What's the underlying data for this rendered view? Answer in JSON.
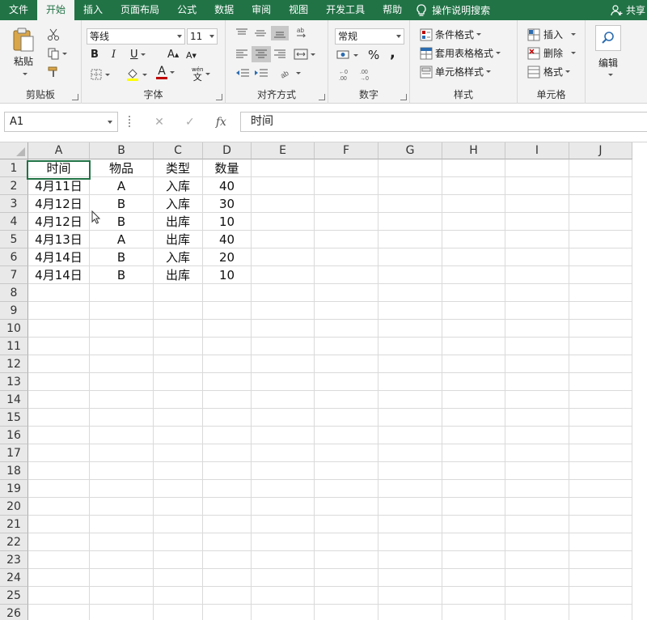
{
  "menu": {
    "tabs": [
      "文件",
      "开始",
      "插入",
      "页面布局",
      "公式",
      "数据",
      "审阅",
      "视图",
      "开发工具",
      "帮助"
    ],
    "active_tab": "开始",
    "tell_me": "操作说明搜索",
    "share": "共享"
  },
  "ribbon": {
    "clipboard": {
      "label": "剪贴板",
      "paste": "粘贴"
    },
    "font": {
      "label": "字体",
      "font_name": "等线",
      "font_size": "11",
      "bold": "B",
      "italic": "I",
      "underline": "U",
      "grow": "A",
      "shrink": "A",
      "color_letter": "A",
      "phonetic_top": "wén",
      "phonetic": "文"
    },
    "alignment": {
      "label": "对齐方式"
    },
    "number": {
      "label": "数字",
      "format": "常规",
      "percent": "%",
      "comma": ","
    },
    "styles": {
      "label": "样式",
      "conditional": "条件格式",
      "table": "套用表格格式",
      "cell_styles": "单元格样式"
    },
    "cells": {
      "label": "单元格",
      "insert": "插入",
      "delete": "删除",
      "format": "格式"
    },
    "editing": {
      "label": "编辑"
    }
  },
  "formula_bar": {
    "name_box": "A1",
    "cancel": "✕",
    "enter": "✓",
    "fx": "fx",
    "content": "时间"
  },
  "sheet": {
    "columns": [
      "A",
      "B",
      "C",
      "D",
      "E",
      "F",
      "G",
      "H",
      "I",
      "J"
    ],
    "rows": [
      "1",
      "2",
      "3",
      "4",
      "5",
      "6",
      "7",
      "8",
      "9",
      "10",
      "11",
      "12",
      "13",
      "14",
      "15",
      "16",
      "17",
      "18",
      "19",
      "20",
      "21",
      "22",
      "23",
      "24",
      "25",
      "26"
    ],
    "data": [
      [
        "时间",
        "物品",
        "类型",
        "数量"
      ],
      [
        "4月11日",
        "A",
        "入库",
        "40"
      ],
      [
        "4月12日",
        "B",
        "入库",
        "30"
      ],
      [
        "4月12日",
        "B",
        "出库",
        "10"
      ],
      [
        "4月13日",
        "A",
        "出库",
        "40"
      ],
      [
        "4月14日",
        "B",
        "入库",
        "20"
      ],
      [
        "4月14日",
        "B",
        "出库",
        "10"
      ]
    ]
  },
  "colors": {
    "accent": "#217346",
    "ribbon_bg": "#f3f3f3",
    "header_bg": "#e9e9e9"
  }
}
